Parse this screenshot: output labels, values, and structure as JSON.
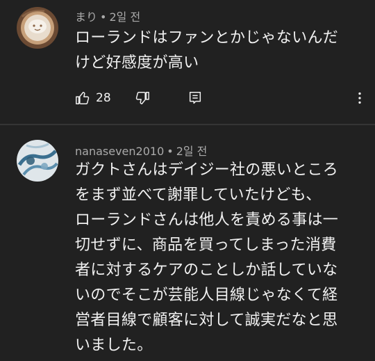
{
  "comments": [
    {
      "author": "まり",
      "age": "2일 전",
      "lines": [
        "ローランドはファンとかじゃないんだ",
        "けど好感度が高い"
      ],
      "like_count": "28"
    },
    {
      "author": "nanaseven2010",
      "age": "2일 전",
      "lines": [
        "ガクトさんはデイジー社の悪いところ",
        "をまず並べて謝罪していたけども、",
        "ローランドさんは他人を責める事は一",
        "切せずに、商品を買ってしまった消費",
        "者に対するケアのことしか話していな",
        "いのでそこが芸能人目線じゃなくて経",
        "営者目線で顧客に対して誠実だなと思",
        "いました。"
      ]
    }
  ],
  "meta_separator": "•",
  "icons": {
    "like": "thumbs-up-icon",
    "dislike": "thumbs-down-icon",
    "reply": "reply-comment-icon",
    "more": "more-vertical-icon"
  },
  "colors": {
    "background": "#212121",
    "text": "#f1f1f1",
    "meta": "#aaaaaa",
    "divider": "#353535"
  }
}
